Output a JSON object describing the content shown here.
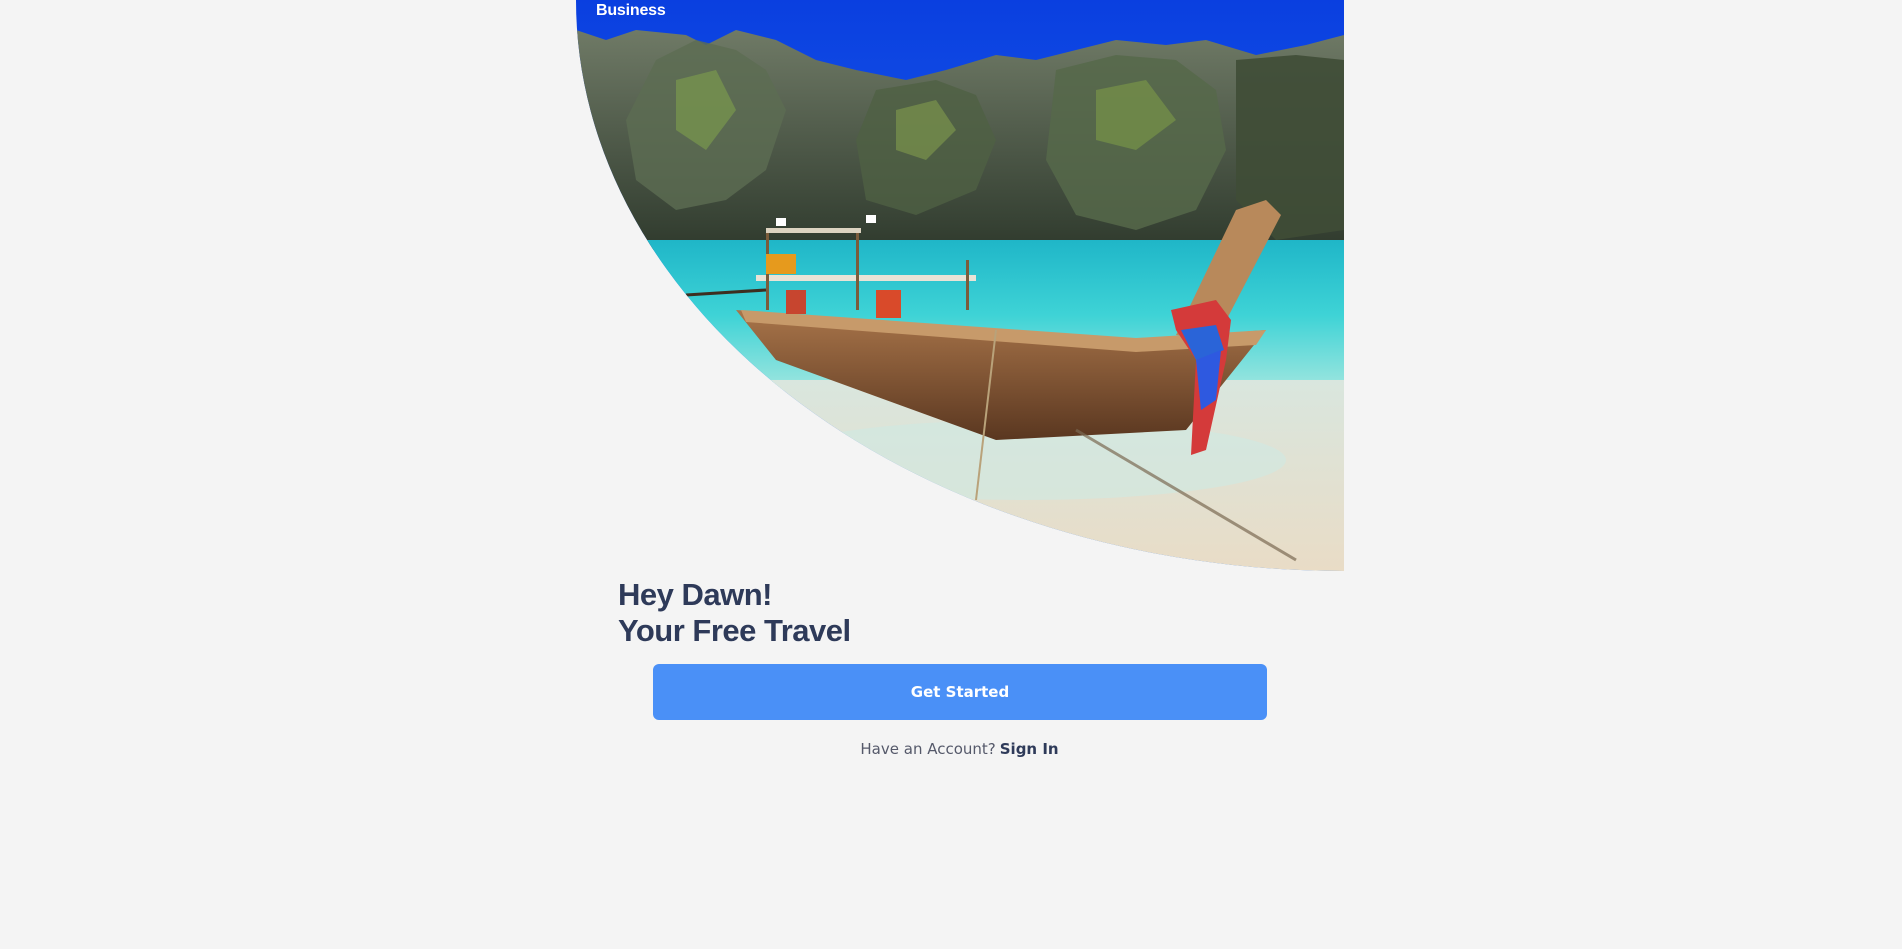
{
  "brand": {
    "label": "Business"
  },
  "hero": {
    "image": "tropical-beach-longtail-boat-photo"
  },
  "greeting": {
    "line1": "Hey Dawn!",
    "line2": "Your Free Travel"
  },
  "cta": {
    "label": "Get Started"
  },
  "signin": {
    "prompt": "Have an Account?",
    "link": "Sign In"
  },
  "colors": {
    "background": "#f4f4f4",
    "primary_button": "#4a90f7",
    "heading": "#2e3a59"
  }
}
